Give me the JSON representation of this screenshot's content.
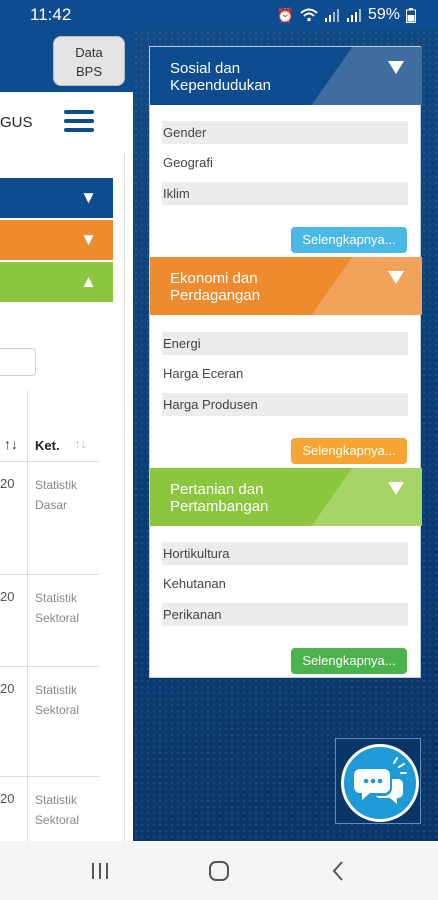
{
  "status_bar": {
    "time": "11:42",
    "battery": "59%",
    "icons": [
      "alarm-icon",
      "wifi-icon",
      "signal-icon",
      "signal-icon",
      "battery-icon"
    ]
  },
  "left_page": {
    "data_button_line1": "Data",
    "data_button_line2": "BPS",
    "title_fragment": "GUS",
    "table": {
      "header_ket": "Ket.",
      "rows": [
        {
          "year_fragment": "20",
          "ket_line1": "Statistik",
          "ket_line2": "Dasar"
        },
        {
          "year_fragment": "20",
          "ket_line1": "Statistik",
          "ket_line2": "Sektoral"
        },
        {
          "year_fragment": "20",
          "ket_line1": "Statistik",
          "ket_line2": "Sektoral"
        },
        {
          "year_fragment": "20",
          "ket_line1": "Statistik",
          "ket_line2": "Sektoral"
        }
      ]
    }
  },
  "drawer": {
    "categories": [
      {
        "title_line1": "Sosial dan",
        "title_line2": "Kependudukan",
        "color": "#0f4c8f",
        "items": [
          "Gender",
          "Geografi",
          "Iklim"
        ],
        "more_label": "Selengkapnya..."
      },
      {
        "title_line1": "Ekonomi dan",
        "title_line2": "Perdagangan",
        "color": "#ee8b2f",
        "items": [
          "Energi",
          "Harga Eceran",
          "Harga Produsen"
        ],
        "more_label": "Selengkapnya..."
      },
      {
        "title_line1": "Pertanian dan",
        "title_line2": "Pertambangan",
        "color": "#8cc63f",
        "items": [
          "Hortikultura",
          "Kehutanan",
          "Perikanan"
        ],
        "more_label": "Selengkapnya..."
      }
    ]
  },
  "chat": {
    "icon": "chat-bubbles-icon"
  },
  "nav_bar": {
    "icons": [
      "recent-apps-icon",
      "home-icon",
      "back-icon"
    ]
  }
}
